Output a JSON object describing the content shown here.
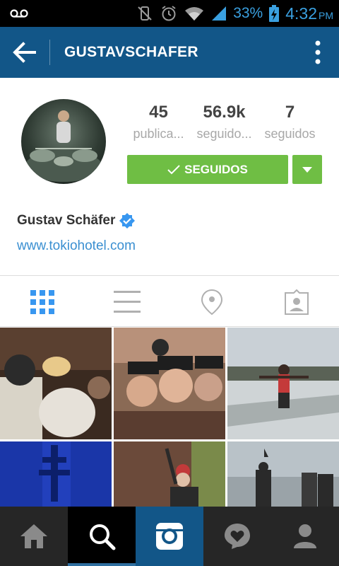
{
  "status_bar": {
    "battery_percent": "33%",
    "time": "4:32",
    "ampm": "PM",
    "accent_color": "#3aa0e0"
  },
  "action_bar": {
    "title": "GUSTAVSCHAFER",
    "background": "#125688",
    "back_icon": "arrow-left-icon",
    "menu_icon": "overflow-menu-icon"
  },
  "profile": {
    "stats": [
      {
        "value": "45",
        "label": "publica..."
      },
      {
        "value": "56.9k",
        "label": "seguido..."
      },
      {
        "value": "7",
        "label": "seguidos"
      }
    ],
    "follow_button_label": "SEGUIDOS",
    "follow_button_color": "#6fbe44",
    "name": "Gustav Schäfer",
    "verified_icon": "verified-badge-icon",
    "website": "www.tokiohotel.com"
  },
  "view_tabs": [
    {
      "icon": "grid-view-icon",
      "active": true
    },
    {
      "icon": "list-view-icon",
      "active": false
    },
    {
      "icon": "location-pin-icon",
      "active": false
    },
    {
      "icon": "tagged-photos-icon",
      "active": false
    }
  ],
  "photos": [
    {
      "name": "photo-1"
    },
    {
      "name": "photo-2"
    },
    {
      "name": "photo-3"
    },
    {
      "name": "photo-4"
    },
    {
      "name": "photo-5"
    },
    {
      "name": "photo-6"
    }
  ],
  "bottom_nav": [
    {
      "icon": "home-icon",
      "active": false
    },
    {
      "icon": "search-icon",
      "active": true
    },
    {
      "icon": "camera-icon",
      "active": false
    },
    {
      "icon": "activity-heart-icon",
      "active": false
    },
    {
      "icon": "profile-icon",
      "active": false
    }
  ]
}
